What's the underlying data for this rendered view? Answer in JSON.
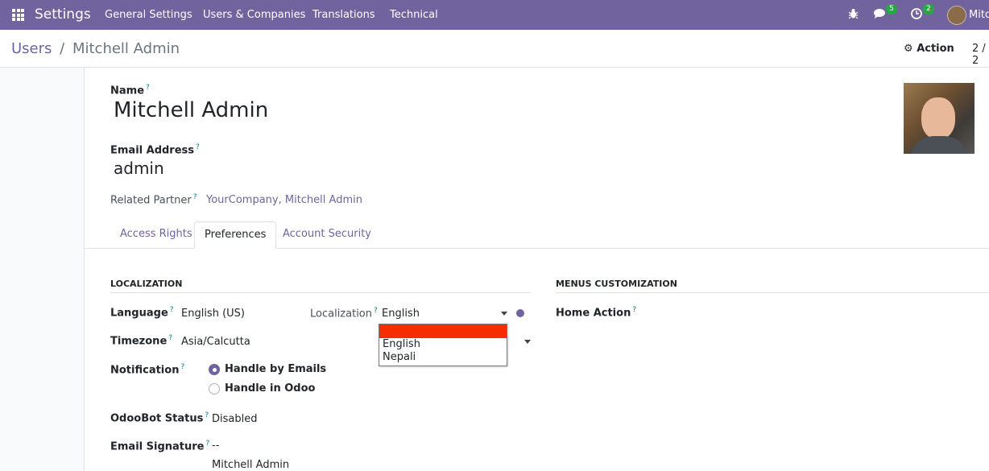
{
  "topbar": {
    "app_name": "Settings",
    "menu": [
      "General Settings",
      "Users & Companies",
      "Translations",
      "Technical"
    ],
    "messages_count": "5",
    "activities_count": "2",
    "user_short": "Mitc"
  },
  "breadcrumb": {
    "parent": "Users",
    "separator": "/",
    "current": "Mitchell Admin"
  },
  "control": {
    "action_label": "Action",
    "pager": "2 / 2"
  },
  "form": {
    "name_label": "Name",
    "name_value": "Mitchell Admin",
    "email_label": "Email Address",
    "email_value": "admin",
    "partner_label": "Related Partner",
    "partner_value": "YourCompany, Mitchell Admin",
    "help_mark": "?"
  },
  "tabs": [
    "Access Rights",
    "Preferences",
    "Account Security"
  ],
  "localization": {
    "title": "LOCALIZATION",
    "language_label": "Language",
    "language_value": "English (US)",
    "localization_label": "Localization",
    "localization_value": "English",
    "timezone_label": "Timezone",
    "timezone_value": "Asia/Calcutta",
    "notification_label": "Notification",
    "notification_options": [
      "Handle by Emails",
      "Handle in Odoo"
    ],
    "notification_selected": "Handle by Emails",
    "odoobot_label": "OdooBot Status",
    "odoobot_value": "Disabled",
    "signature_label": "Email Signature",
    "signature_lines": [
      "--",
      "Mitchell Admin"
    ]
  },
  "dropdown": {
    "options": [
      "",
      "English",
      "Nepali"
    ],
    "highlight_color": "#f52d00"
  },
  "menus": {
    "title": "MENUS CUSTOMIZATION",
    "home_action_label": "Home Action"
  },
  "colors": {
    "brand": "#71639e",
    "badge": "#28a745"
  }
}
